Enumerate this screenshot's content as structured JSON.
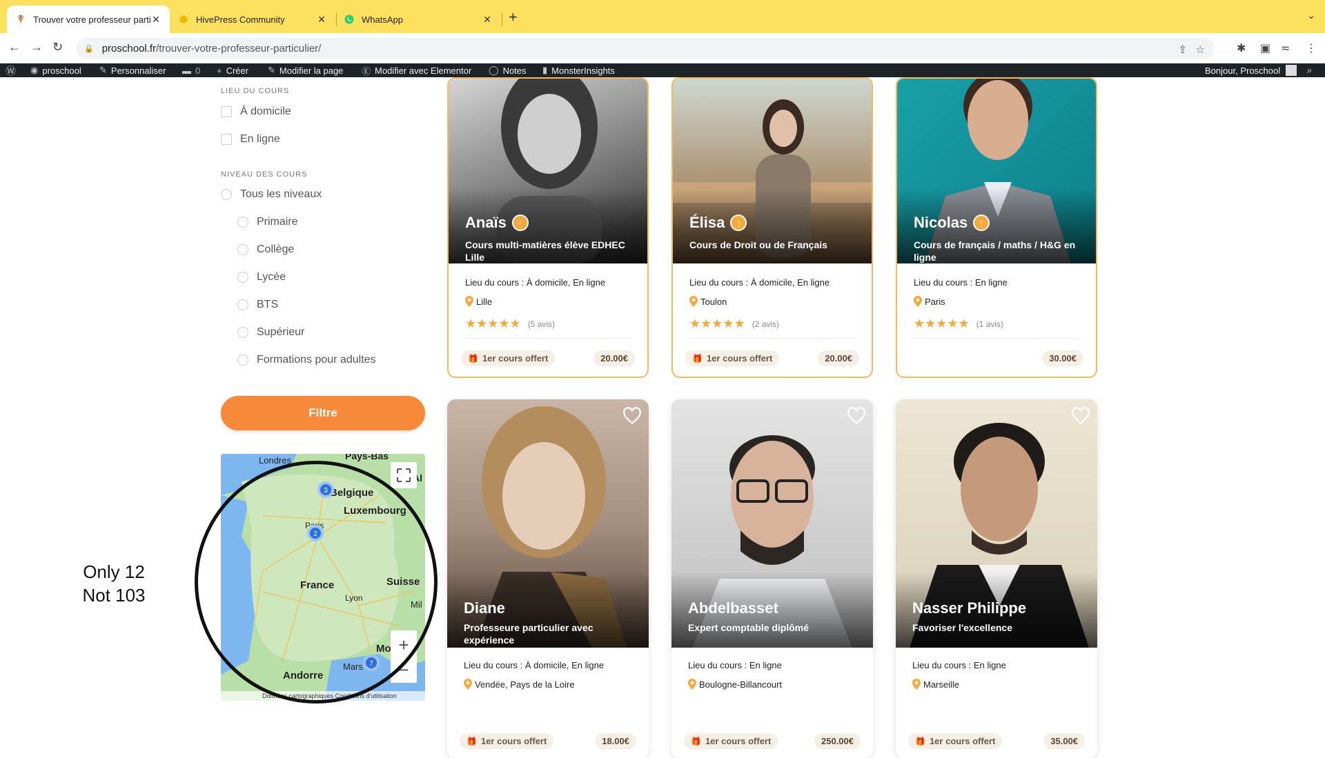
{
  "browser": {
    "tabs": [
      {
        "title": "Trouver votre professeur particulier",
        "active": true
      },
      {
        "title": "HivePress Community",
        "active": false
      },
      {
        "title": "WhatsApp",
        "active": false
      }
    ],
    "url_host": "proschool.fr",
    "url_path": "/trouver-votre-professeur-particulier/"
  },
  "wpbar": {
    "site": "proschool",
    "customize": "Personnaliser",
    "comments": "0",
    "create": "Créer",
    "edit_page": "Modifier la page",
    "elementor": "Modifier avec Elementor",
    "notes": "Notes",
    "insights": "MonsterInsights",
    "greeting": "Bonjour, Proschool"
  },
  "filters": {
    "lieu_title": "LIEU DU COURS",
    "lieu_options": [
      "À domicile",
      "En ligne"
    ],
    "niveau_title": "NIVEAU DES COURS",
    "niveau_all": "Tous les niveaux",
    "niveau_options": [
      "Primaire",
      "Collège",
      "Lycée",
      "BTS",
      "Supérieur",
      "Formations pour adultes"
    ],
    "button": "Filtre"
  },
  "map": {
    "labels": {
      "londres": "Londres",
      "paysbas": "Pays-Bas",
      "belgique": "Belgique",
      "luxembourg": "Luxembourg",
      "paris": "Paris",
      "france": "France",
      "suisse": "Suisse",
      "lyon": "Lyon",
      "mil": "Mil",
      "mo": "Mo",
      "marseille": "Mars",
      "andorre": "Andorre",
      "al": "Al",
      "footer": "Données cartographiques   Conditions d'utilisation"
    },
    "clusters": [
      "3",
      "2",
      "7"
    ],
    "zoom_in": "+",
    "zoom_out": "−"
  },
  "annotation": {
    "line1": "Only 12",
    "line2": "Not 103"
  },
  "teachers": [
    {
      "name": "Anaïs",
      "subtitle": "Cours multi-matières élève EDHEC Lille",
      "lieu": "Lieu du cours : À domicile, En ligne",
      "city": "Lille",
      "stars": "★★★★★",
      "avis": "(5 avis)",
      "offer": "1er cours offert",
      "price": "20.00€"
    },
    {
      "name": "Élisa",
      "subtitle": "Cours de Droit ou de Français",
      "lieu": "Lieu du cours : À domicile, En ligne",
      "city": "Toulon",
      "stars": "★★★★★",
      "avis": "(2 avis)",
      "offer": "1er cours offert",
      "price": "20.00€"
    },
    {
      "name": "Nicolas",
      "subtitle": "Cours de français / maths / H&G en ligne",
      "lieu": "Lieu du cours : En ligne",
      "city": "Paris",
      "stars": "★★★★★",
      "avis": "(1 avis)",
      "offer": "",
      "price": "30.00€"
    },
    {
      "name": "Diane",
      "subtitle": "Professeure particulier avec expérience",
      "lieu": "Lieu du cours : À domicile, En ligne",
      "city": "Vendée, Pays de la Loire",
      "offer": "1er cours offert",
      "price": "18.00€"
    },
    {
      "name": "Abdelbasset",
      "subtitle": "Expert comptable diplômé",
      "lieu": "Lieu du cours : En ligne",
      "city": "Boulogne-Billancourt",
      "offer": "1er cours offert",
      "price": "250.00€"
    },
    {
      "name": "Nasser Philippe",
      "subtitle": "Favoriser l'excellence",
      "lieu": "Lieu du cours : En ligne",
      "city": "Marseille",
      "offer": "1er cours offert",
      "price": "35.00€"
    }
  ],
  "colors": {
    "accent": "#f6893a",
    "star": "#f6a93a",
    "tabbar": "#fbe15d"
  }
}
